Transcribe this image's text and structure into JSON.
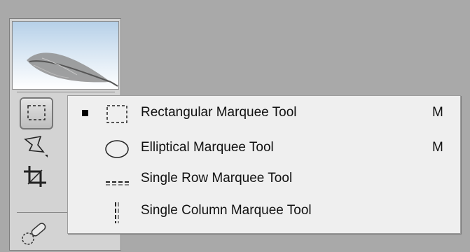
{
  "toolbar": {
    "thumbnail_icon": "feather-thumbnail",
    "tools": [
      {
        "name": "rectangular-marquee-icon"
      },
      {
        "name": "lasso-icon"
      },
      {
        "name": "crop-icon"
      },
      {
        "name": "healing-brush-icon"
      }
    ]
  },
  "flyout": {
    "items": [
      {
        "label": "Rectangular Marquee Tool",
        "shortcut": "M",
        "selected": true,
        "icon": "rectangular-marquee-icon"
      },
      {
        "label": "Elliptical Marquee Tool",
        "shortcut": "M",
        "selected": false,
        "icon": "elliptical-marquee-icon"
      },
      {
        "label": "Single Row Marquee Tool",
        "shortcut": "",
        "selected": false,
        "icon": "single-row-marquee-icon"
      },
      {
        "label": "Single Column Marquee Tool",
        "shortcut": "",
        "selected": false,
        "icon": "single-column-marquee-icon"
      }
    ]
  },
  "colors": {
    "canvas": "#a9a9a9",
    "panel": "#d3d3d3",
    "menu": "#efefef"
  }
}
